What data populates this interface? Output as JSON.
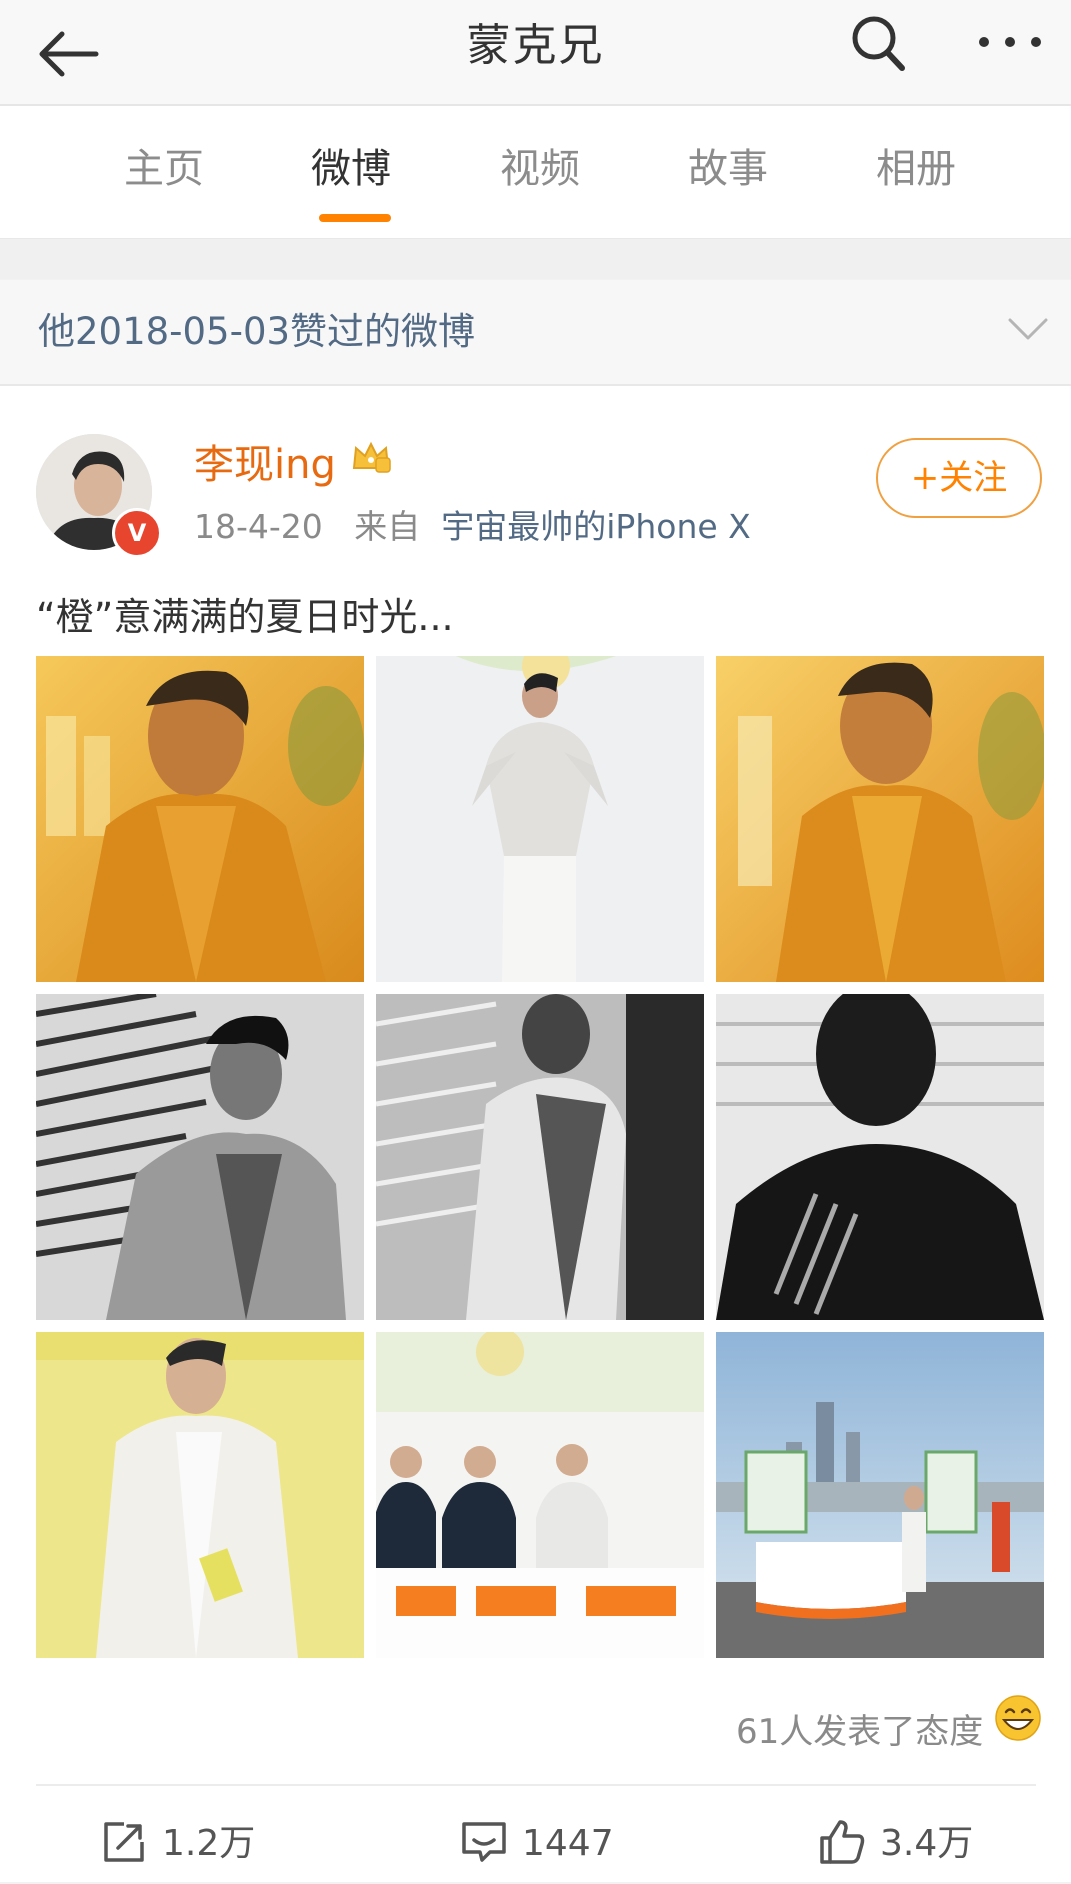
{
  "header": {
    "title": "蒙克兄"
  },
  "tabs": [
    {
      "label": "主页"
    },
    {
      "label": "微博"
    },
    {
      "label": "视频"
    },
    {
      "label": "故事"
    },
    {
      "label": "相册"
    }
  ],
  "active_tab": "微博",
  "liked_bar": {
    "text": "他2018-05-03赞过的微博"
  },
  "post": {
    "username": "李现ing",
    "date": "18-4-20",
    "from_prefix": "来自",
    "source": "宇宙最帅的iPhone X",
    "follow_label": "+关注",
    "verified_badge": "V",
    "text": "“橙”意满满的夏日时光...",
    "photos": [
      {
        "icon": "photo-orange-jacket-portrait"
      },
      {
        "icon": "photo-white-suit-heart-hands"
      },
      {
        "icon": "photo-orange-jacket-closeup"
      },
      {
        "icon": "photo-bw-blinds-jacket"
      },
      {
        "icon": "photo-bw-blinds-side"
      },
      {
        "icon": "photo-bw-shadow-face"
      },
      {
        "icon": "photo-yellow-backdrop-mic"
      },
      {
        "icon": "photo-event-group"
      },
      {
        "icon": "photo-skyline-booth"
      }
    ],
    "reactions": "61人发表了态度",
    "actions": {
      "repost": "1.2万",
      "comment": "1447",
      "like": "3.4万"
    }
  },
  "colors": {
    "accent": "#ff8200",
    "link": "#536a84",
    "username": "#e86a10"
  }
}
